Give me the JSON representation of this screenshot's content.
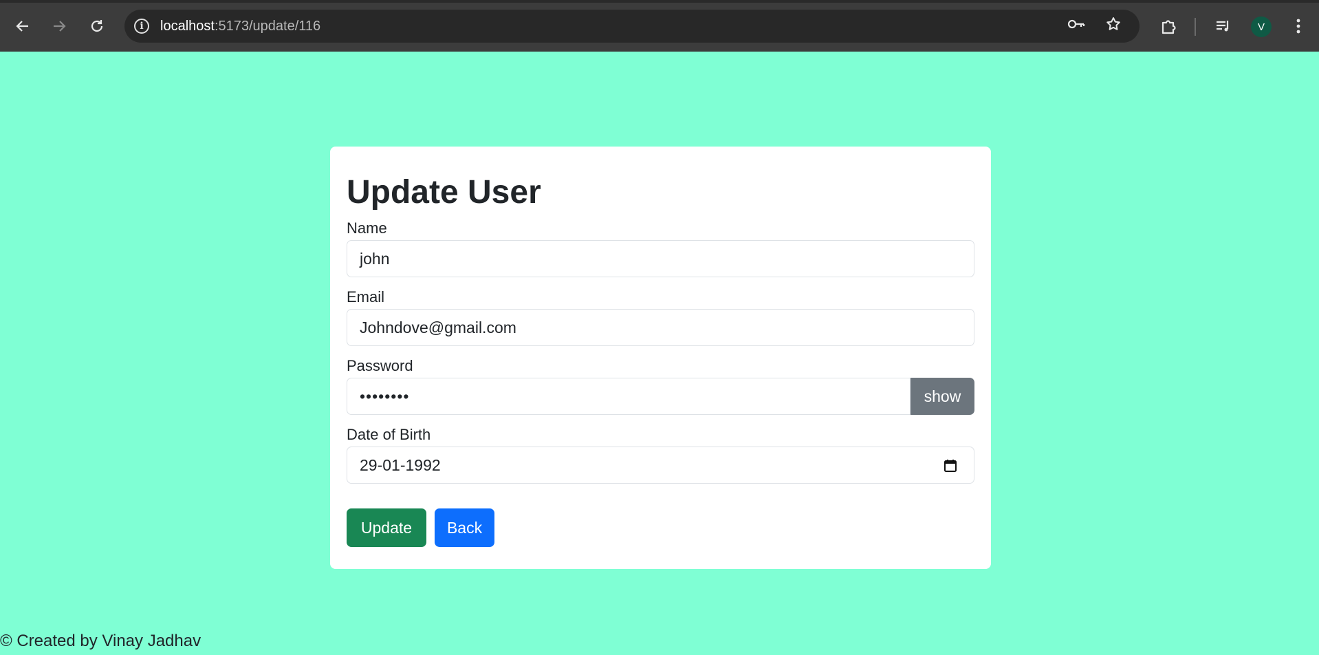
{
  "browser": {
    "url_host": "localhost",
    "url_path": ":5173/update/116",
    "avatar_letter": "V",
    "icons": [
      "back-icon",
      "forward-icon",
      "reload-icon",
      "site-info-icon",
      "key-icon",
      "star-icon",
      "extensions-icon",
      "media-icon",
      "menu-icon"
    ]
  },
  "form": {
    "title": "Update User",
    "name_label": "Name",
    "name_value": "john",
    "email_label": "Email",
    "email_value": "Johndove@gmail.com",
    "password_label": "Password",
    "password_value": "••••••••",
    "show_label": "show",
    "dob_label": "Date of Birth",
    "dob_value": "29-01-1992",
    "update_label": "Update",
    "back_label": "Back"
  },
  "footer": {
    "text": "© Created by Vinay Jadhav"
  },
  "colors": {
    "page_bg": "#7fffd4",
    "update_button": "#198754",
    "back_button": "#0d6efd",
    "show_button": "#6c757d"
  }
}
